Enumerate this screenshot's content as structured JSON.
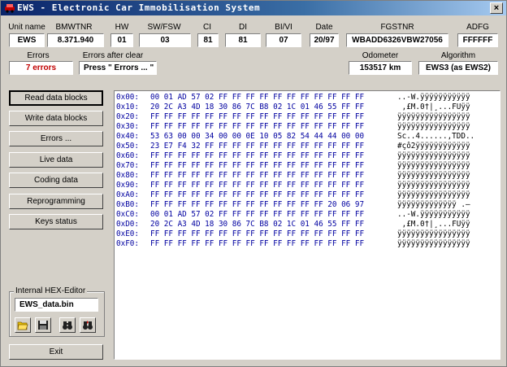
{
  "window": {
    "title": "EWS - Electronic Car Immobilisation System",
    "close_glyph": "×"
  },
  "info": {
    "unit_name": {
      "label": "Unit name",
      "value": "EWS"
    },
    "bmwtnr": {
      "label": "BMWTNR",
      "value": "8.371.940"
    },
    "hw": {
      "label": "HW",
      "value": "01"
    },
    "sw_fsw": {
      "label": "SW/FSW",
      "value": "03"
    },
    "ci": {
      "label": "CI",
      "value": "81"
    },
    "di": {
      "label": "DI",
      "value": "81"
    },
    "bi_vi": {
      "label": "BI/VI",
      "value": "07"
    },
    "date": {
      "label": "Date",
      "value": "20/97"
    },
    "fgstnr": {
      "label": "FGSTNR",
      "value": "WBADD6326VBW27056"
    },
    "adfg": {
      "label": "ADFG",
      "value": "FFFFFF"
    },
    "errors": {
      "label": "Errors",
      "value": "7 errors"
    },
    "errors_after_clear": {
      "label": "Errors after clear",
      "value": "Press \" Errors ... \""
    },
    "odometer": {
      "label": "Odometer",
      "value": "153517 km"
    },
    "algorithm": {
      "label": "Algorithm",
      "value": "EWS3 (as EWS2)"
    }
  },
  "buttons": {
    "read": "Read data blocks",
    "write": "Write data blocks",
    "errors": "Errors ...",
    "live": "Live data",
    "coding": "Coding data",
    "reprogramming": "Reprogramming",
    "keys": "Keys status",
    "exit": "Exit"
  },
  "hex_editor": {
    "group_label": "Internal HEX-Editor",
    "filename": "EWS_data.bin"
  },
  "hex_dump": [
    {
      "addr": "0x00:",
      "bytes": "00 01 AD 57 02 FF FF FF FF FF FF FF FF FF FF FF",
      "ascii": "..-W.ÿÿÿÿÿÿÿÿÿÿÿ"
    },
    {
      "addr": "0x10:",
      "bytes": "20 2C A3 4D 18 30 86 7C B8 02 1C 01 46 55 FF FF",
      "ascii": " ,£M.0†|¸...FUÿÿ"
    },
    {
      "addr": "0x20:",
      "bytes": "FF FF FF FF FF FF FF FF FF FF FF FF FF FF FF FF",
      "ascii": "ÿÿÿÿÿÿÿÿÿÿÿÿÿÿÿÿ"
    },
    {
      "addr": "0x30:",
      "bytes": "FF FF FF FF FF FF FF FF FF FF FF FF FF FF FF FF",
      "ascii": "ÿÿÿÿÿÿÿÿÿÿÿÿÿÿÿÿ"
    },
    {
      "addr": "0x40:",
      "bytes": "53 63 00 00 34 00 00 0E 10 05 82 54 44 44 00 00",
      "ascii": "Sc..4......‚TDD.."
    },
    {
      "addr": "0x50:",
      "bytes": "23 E7 F4 32 FF FF FF FF FF FF FF FF FF FF FF FF",
      "ascii": "#çô2ÿÿÿÿÿÿÿÿÿÿÿÿ"
    },
    {
      "addr": "0x60:",
      "bytes": "FF FF FF FF FF FF FF FF FF FF FF FF FF FF FF FF",
      "ascii": "ÿÿÿÿÿÿÿÿÿÿÿÿÿÿÿÿ"
    },
    {
      "addr": "0x70:",
      "bytes": "FF FF FF FF FF FF FF FF FF FF FF FF FF FF FF FF",
      "ascii": "ÿÿÿÿÿÿÿÿÿÿÿÿÿÿÿÿ"
    },
    {
      "addr": "0x80:",
      "bytes": "FF FF FF FF FF FF FF FF FF FF FF FF FF FF FF FF",
      "ascii": "ÿÿÿÿÿÿÿÿÿÿÿÿÿÿÿÿ"
    },
    {
      "addr": "0x90:",
      "bytes": "FF FF FF FF FF FF FF FF FF FF FF FF FF FF FF FF",
      "ascii": "ÿÿÿÿÿÿÿÿÿÿÿÿÿÿÿÿ"
    },
    {
      "addr": "0xA0:",
      "bytes": "FF FF FF FF FF FF FF FF FF FF FF FF FF FF FF FF",
      "ascii": "ÿÿÿÿÿÿÿÿÿÿÿÿÿÿÿÿ"
    },
    {
      "addr": "0xB0:",
      "bytes": "FF FF FF FF FF FF FF FF FF FF FF FF FF 20 06 97",
      "ascii": "ÿÿÿÿÿÿÿÿÿÿÿÿÿ .—"
    },
    {
      "addr": "0xC0:",
      "bytes": "00 01 AD 57 02 FF FF FF FF FF FF FF FF FF FF FF",
      "ascii": "..-W.ÿÿÿÿÿÿÿÿÿÿÿ"
    },
    {
      "addr": "0xD0:",
      "bytes": "20 2C A3 4D 18 30 86 7C B8 02 1C 01 46 55 FF FF",
      "ascii": " ,£M.0†|¸...FUÿÿ"
    },
    {
      "addr": "0xE0:",
      "bytes": "FF FF FF FF FF FF FF FF FF FF FF FF FF FF FF FF",
      "ascii": "ÿÿÿÿÿÿÿÿÿÿÿÿÿÿÿÿ"
    },
    {
      "addr": "0xF0:",
      "bytes": "FF FF FF FF FF FF FF FF FF FF FF FF FF FF FF FF",
      "ascii": "ÿÿÿÿÿÿÿÿÿÿÿÿÿÿÿÿ"
    }
  ],
  "colors": {
    "title_bar": "#0a246a",
    "error_text": "#c00000",
    "hex_text": "#0000a0",
    "window_bg": "#d4d0c8"
  },
  "icons": {
    "open": "open-folder-icon",
    "save": "save-disk-icon",
    "find": "binoculars-icon",
    "find_next": "binoculars-next-icon"
  }
}
